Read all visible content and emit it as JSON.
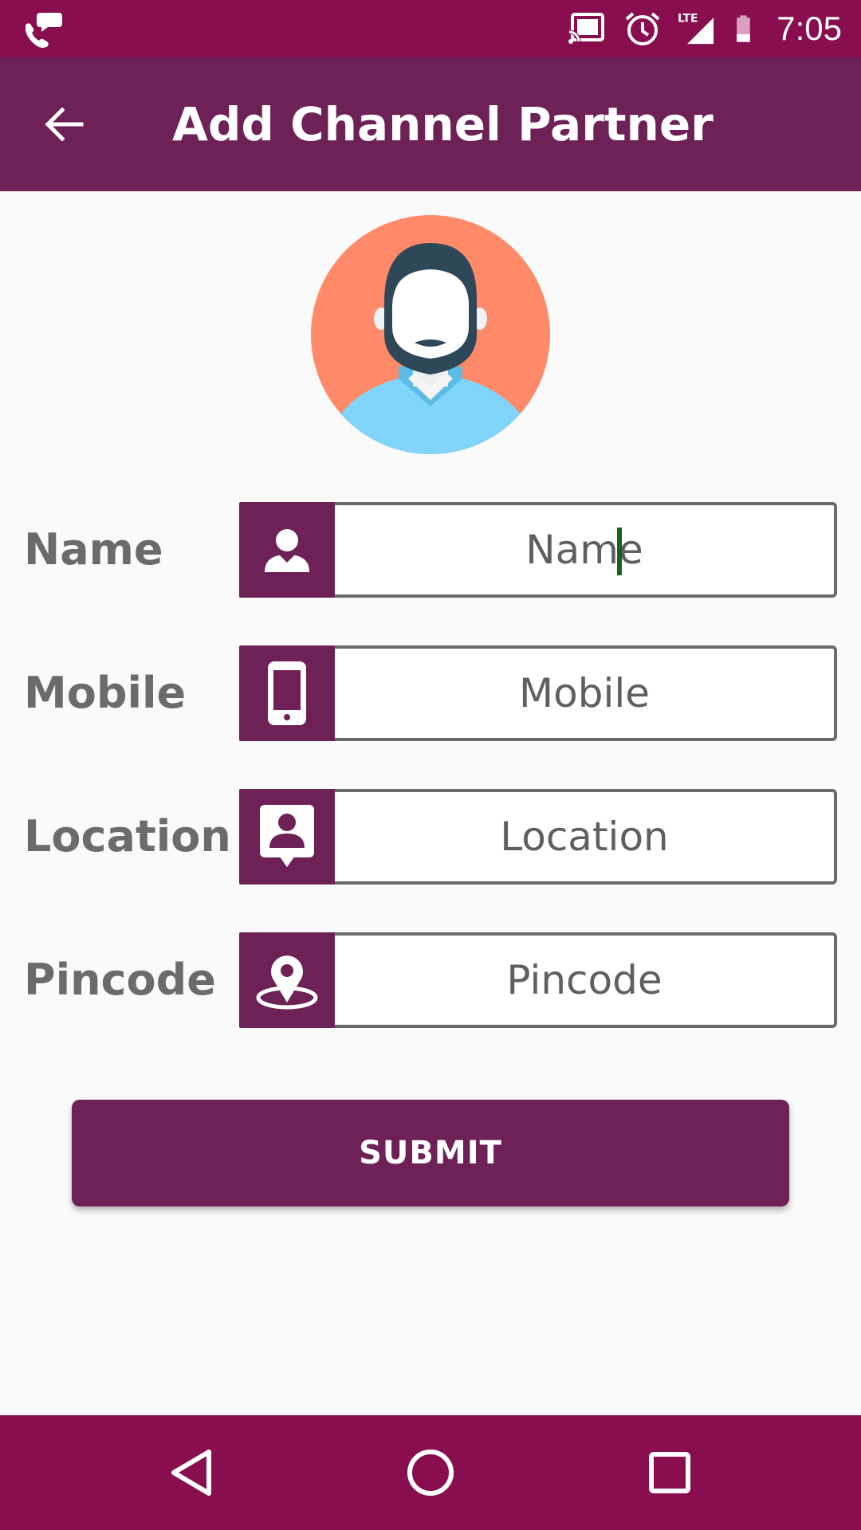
{
  "status_bar": {
    "time": "7:05",
    "network": "LTE",
    "icons": [
      "phone-chat-icon",
      "cast-icon",
      "alarm-icon",
      "signal-icon",
      "battery-icon"
    ]
  },
  "app_bar": {
    "title": "Add Channel Partner",
    "back_icon": "arrow-left-icon"
  },
  "form": {
    "fields": [
      {
        "label": "Name",
        "placeholder": "Name",
        "value": "",
        "icon": "person-icon"
      },
      {
        "label": "Mobile",
        "placeholder": "Mobile",
        "value": "",
        "icon": "smartphone-icon"
      },
      {
        "label": "Location",
        "placeholder": "Location",
        "value": "",
        "icon": "contact-card-icon"
      },
      {
        "label": "Pincode",
        "placeholder": "Pincode",
        "value": "",
        "icon": "map-pin-icon"
      }
    ],
    "submit_label": "SUBMIT"
  },
  "nav_bar": {
    "buttons": [
      "back-triangle-icon",
      "home-circle-icon",
      "recents-square-icon"
    ]
  },
  "colors": {
    "status_bar": "#880e4f",
    "primary": "#6d2157",
    "avatar_bg": "#ff8a6a",
    "avatar_hair": "#2f4859",
    "avatar_shirt": "#81d4fa",
    "cursor": "#1b5e20"
  }
}
